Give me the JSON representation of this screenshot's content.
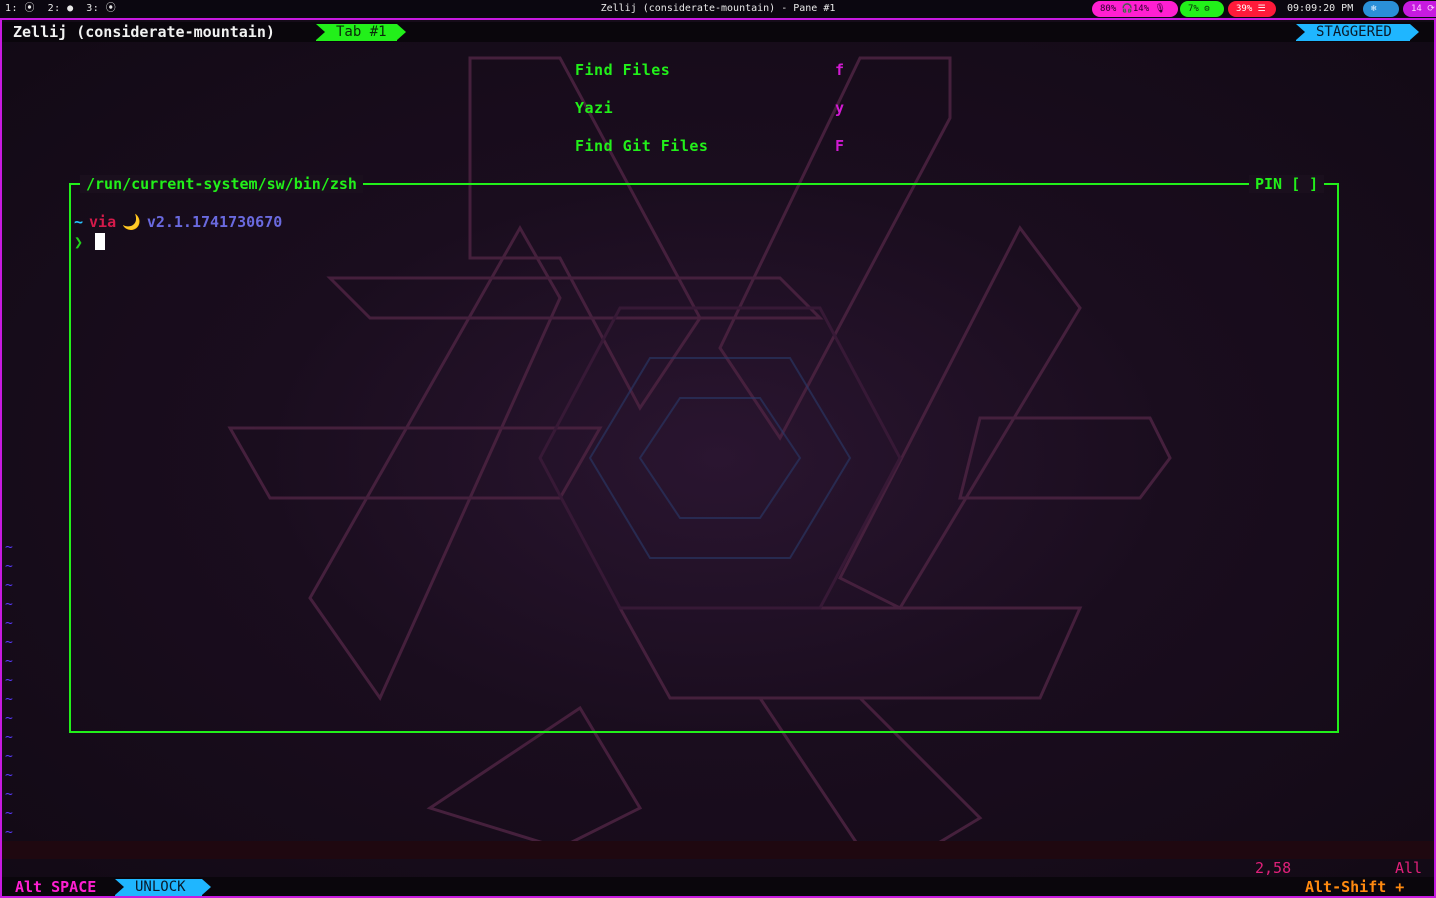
{
  "topbar": {
    "workspaces": [
      "1: ⦿",
      "2: ●",
      "3: ⦿"
    ],
    "window_title": "Zellij (considerate-mountain) - Pane #1",
    "audio": "80% 🎧14% 🎙",
    "cpu": "7% ⚙",
    "memory": "39% ☰",
    "clock": "09:09:20 PM",
    "nix_icon": "❄",
    "updates": "14 ⟳"
  },
  "zellij": {
    "session": "Zellij (considerate-mountain)",
    "tab": "Tab #1",
    "layout_mode": "STAGGERED"
  },
  "menu": {
    "items": [
      {
        "label": "Find Files",
        "key": "f"
      },
      {
        "label": "Yazi",
        "key": "y"
      },
      {
        "label": "Find Git Files",
        "key": "F"
      }
    ]
  },
  "pane": {
    "title": "/run/current-system/sw/bin/zsh",
    "pin": "PIN [ ]",
    "prompt": {
      "dir": "~",
      "via": "via",
      "moon": "🌙",
      "version": "v2.1.1741730670",
      "arrow": "❯"
    }
  },
  "statusline": {
    "position": "2,58",
    "scroll": "All"
  },
  "bottombar": {
    "modifier": "Alt SPACE",
    "mode": "UNLOCK",
    "hint": "Alt-Shift +"
  },
  "colors": {
    "accent_green": "#22f01a",
    "accent_magenta": "#ff1fd1",
    "accent_cyan": "#1fb6ff",
    "frame_purple": "#c71ae0"
  }
}
